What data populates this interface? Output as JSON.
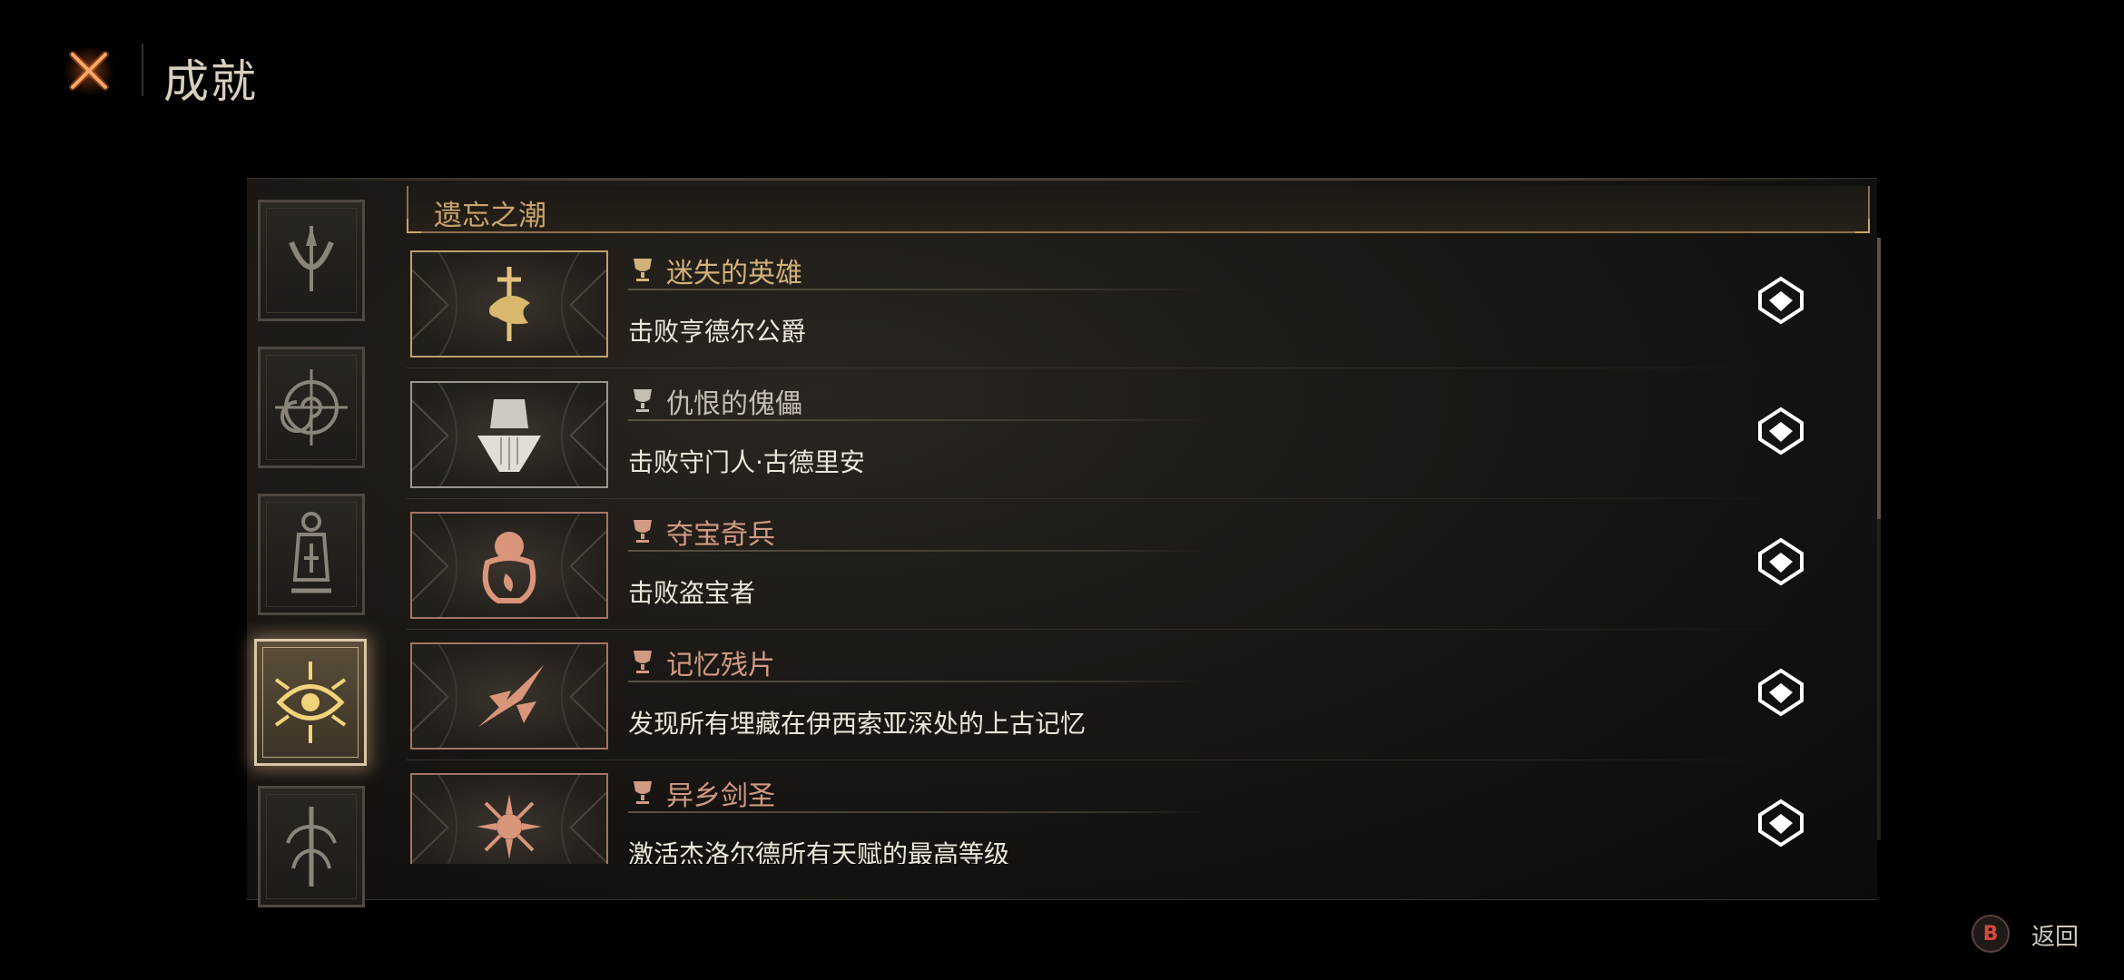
{
  "header": {
    "title": "成就",
    "logo_icon": "crossed-swords-icon"
  },
  "section": {
    "title": "遗忘之潮"
  },
  "categories": [
    {
      "icon": "crescent-spire-icon",
      "active": false
    },
    {
      "icon": "spiral-compass-icon",
      "active": false
    },
    {
      "icon": "lantern-icon",
      "active": false
    },
    {
      "icon": "radiant-eye-icon",
      "active": true
    },
    {
      "icon": "tree-glyph-icon",
      "active": false
    }
  ],
  "achievements": [
    {
      "title": "迷失的英雄",
      "description": "击败亨德尔公爵",
      "tier": "gold",
      "icon": "sword-dragon-icon"
    },
    {
      "title": "仇恨的傀儡",
      "description": "击败守门人·古德里安",
      "tier": "silver",
      "icon": "bearded-golem-icon"
    },
    {
      "title": "夺宝奇兵",
      "description": "击败盗宝者",
      "tier": "bronze",
      "icon": "treasure-bag-icon"
    },
    {
      "title": "记忆残片",
      "description": "发现所有埋藏在伊西索亚深处的上古记忆",
      "tier": "bronze",
      "icon": "shards-icon"
    },
    {
      "title": "异乡剑圣",
      "description": "激活杰洛尔德所有天赋的最高等级",
      "tier": "bronze",
      "icon": "spiked-sun-icon"
    }
  ],
  "footer": {
    "button": "B",
    "label": "返回"
  },
  "colors": {
    "gold": "#d3b27a",
    "silver": "#c4bdb1",
    "bronze": "#d19a82",
    "accent": "#c9a46b"
  }
}
